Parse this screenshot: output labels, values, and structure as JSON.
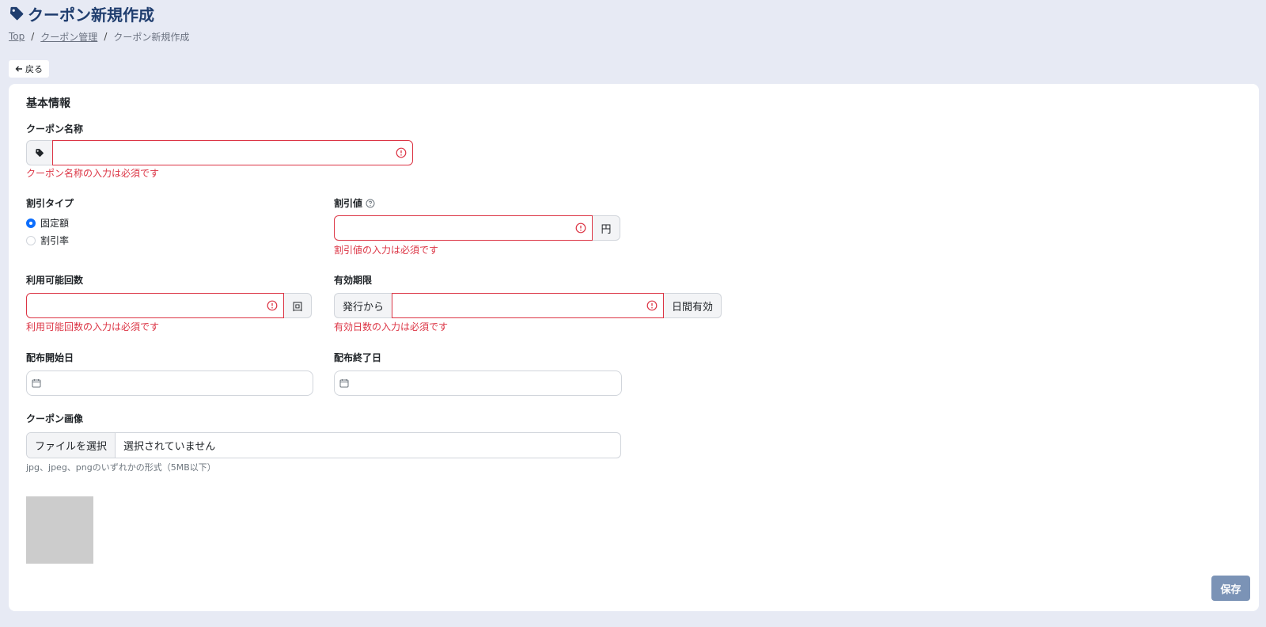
{
  "header": {
    "title": "クーポン新規作成",
    "breadcrumb": {
      "top": "Top",
      "coupon_management": "クーポン管理",
      "current": "クーポン新規作成"
    }
  },
  "back_label": "戻る",
  "form": {
    "section_title": "基本情報",
    "coupon_name": {
      "label": "クーポン名称",
      "value": "",
      "error": "クーポン名称の入力は必須です"
    },
    "discount_type": {
      "label": "割引タイプ",
      "options": [
        {
          "label": "固定額",
          "checked": true
        },
        {
          "label": "割引率",
          "checked": false
        }
      ]
    },
    "discount_value": {
      "label": "割引値",
      "value": "",
      "suffix": "円",
      "error": "割引値の入力は必須です"
    },
    "usage_count": {
      "label": "利用可能回数",
      "value": "",
      "suffix": "回",
      "error": "利用可能回数の入力は必須です"
    },
    "expiry": {
      "label": "有効期限",
      "prefix": "発行から",
      "value": "",
      "suffix": "日間有効",
      "error": "有効日数の入力は必須です"
    },
    "start_date": {
      "label": "配布開始日",
      "value": ""
    },
    "end_date": {
      "label": "配布終了日",
      "value": ""
    },
    "coupon_image": {
      "label": "クーポン画像",
      "button": "ファイルを選択",
      "status": "選択されていません",
      "help": "jpg、jpeg、pngのいずれかの形式（5MB以下）"
    }
  },
  "save_label": "保存",
  "colors": {
    "error": "#dc3545",
    "primary": "#0d6efd",
    "save": "#7b93b6",
    "title": "#1f3d6e"
  }
}
